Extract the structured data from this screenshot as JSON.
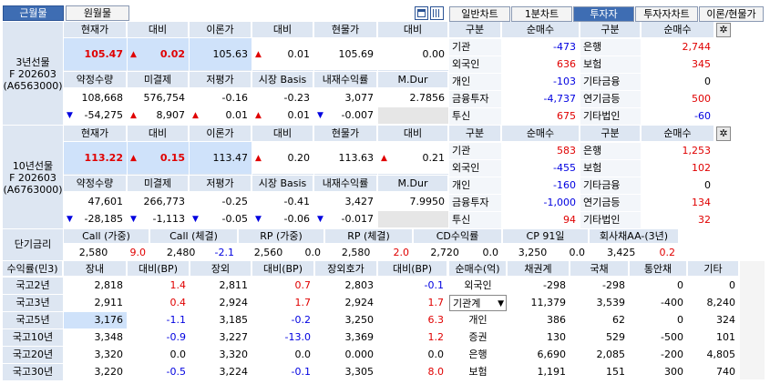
{
  "tabs": {
    "t1": "근월물",
    "t2": "원월물"
  },
  "rtabs": [
    "일반차트",
    "1분차트",
    "투자자",
    "투자자차트",
    "이론/현물가"
  ],
  "fut3": {
    "label1": "3년선물",
    "label2": "F 202603",
    "label3": "(A6563000)",
    "h1": [
      "현재가",
      "대비",
      "이론가",
      "대비",
      "현물가",
      "대비"
    ],
    "v1": [
      "105.47",
      "0.02",
      "105.63",
      "0.01",
      "105.69",
      "0.00"
    ],
    "h2": [
      "약정수량",
      "미결제",
      "저평가",
      "시장 Basis",
      "내재수익률",
      "M.Dur"
    ],
    "v2": [
      "108,668",
      "576,754",
      "-0.16",
      "-0.23",
      "3,077",
      "2.7856"
    ],
    "v3": [
      "-54,275",
      "8,907",
      "0.01",
      "0.01",
      "-0.007",
      ""
    ]
  },
  "fut10": {
    "label1": "10년선물",
    "label2": "F 202603",
    "label3": "(A6763000)",
    "h1": [
      "현재가",
      "대비",
      "이론가",
      "대비",
      "현물가",
      "대비"
    ],
    "v1": [
      "113.22",
      "0.15",
      "113.47",
      "0.20",
      "113.63",
      "0.21"
    ],
    "h2": [
      "약정수량",
      "미결제",
      "저평가",
      "시장 Basis",
      "내재수익률",
      "M.Dur"
    ],
    "v2": [
      "47,601",
      "266,773",
      "-0.25",
      "-0.41",
      "3,427",
      "7.9950"
    ],
    "v3": [
      "-28,185",
      "-1,113",
      "-0.05",
      "-0.06",
      "-0.017",
      ""
    ]
  },
  "inv1": {
    "h": [
      "구분",
      "순매수",
      "구분",
      "순매수"
    ],
    "rows": [
      [
        "기관",
        "-473",
        "은행",
        "2,744"
      ],
      [
        "외국인",
        "636",
        "보험",
        "345"
      ],
      [
        "개인",
        "-103",
        "기타금융",
        "0"
      ],
      [
        "금융투자",
        "-4,737",
        "연기금등",
        "500"
      ],
      [
        "투신",
        "675",
        "기타법인",
        "-60"
      ]
    ]
  },
  "inv2": {
    "h": [
      "구분",
      "순매수",
      "구분",
      "순매수"
    ],
    "rows": [
      [
        "기관",
        "583",
        "은행",
        "1,253"
      ],
      [
        "외국인",
        "-455",
        "보험",
        "102"
      ],
      [
        "개인",
        "-160",
        "기타금융",
        "0"
      ],
      [
        "금융투자",
        "-1,000",
        "연기금등",
        "134"
      ],
      [
        "투신",
        "94",
        "기타법인",
        "32"
      ]
    ]
  },
  "short": {
    "title": "단기금리",
    "heads": [
      "Call (가중)",
      "Call (체결)",
      "RP (가중)",
      "RP (체결)",
      "CD수익률",
      "CP 91일",
      "회사채AA-(3년)"
    ],
    "vals": [
      [
        "2,580",
        "9.0"
      ],
      [
        "2,480",
        "-2.1"
      ],
      [
        "2,560",
        "0.0"
      ],
      [
        "2,580",
        "2.0"
      ],
      [
        "2,720",
        "0.0"
      ],
      [
        "3,250",
        "0.0"
      ],
      [
        "3,425",
        "0.2"
      ]
    ]
  },
  "yields": {
    "h": [
      "수익률(민3)",
      "장내",
      "대비(BP)",
      "장외",
      "대비(BP)",
      "장외호가",
      "대비(BP)"
    ],
    "rows": [
      [
        "국고2년",
        "2,818",
        "1.4",
        "2,811",
        "0.7",
        "2,803",
        "-0.1"
      ],
      [
        "국고3년",
        "2,911",
        "0.4",
        "2,924",
        "1.7",
        "2,924",
        "1.7"
      ],
      [
        "국고5년",
        "3,176",
        "-1.1",
        "3,185",
        "-0.2",
        "3,250",
        "6.3"
      ],
      [
        "국고10년",
        "3,348",
        "-0.9",
        "3,227",
        "-13.0",
        "3,369",
        "1.2"
      ],
      [
        "국고20년",
        "3,320",
        "0.0",
        "3,320",
        "0.0",
        "0.000",
        "0.0"
      ],
      [
        "국고30년",
        "3,220",
        "-0.5",
        "3,224",
        "-0.1",
        "3,305",
        "8.0"
      ]
    ]
  },
  "net": {
    "h": [
      "순매수(억)",
      "채권계",
      "국채",
      "통안채",
      "기타"
    ],
    "rows": [
      [
        "외국인",
        "-298",
        "-298",
        "0",
        "0"
      ],
      [
        "기관계",
        "11,379",
        "3,539",
        "-400",
        "8,240"
      ],
      [
        "개인",
        "386",
        "62",
        "0",
        "324"
      ],
      [
        "증권",
        "130",
        "529",
        "-500",
        "101"
      ],
      [
        "은행",
        "6,690",
        "2,085",
        "-200",
        "4,805"
      ],
      [
        "보험",
        "1,191",
        "151",
        "300",
        "740"
      ]
    ]
  },
  "colors": {
    "up": "#e00000",
    "down": "#0000e0",
    "header": "#dde6f2"
  }
}
